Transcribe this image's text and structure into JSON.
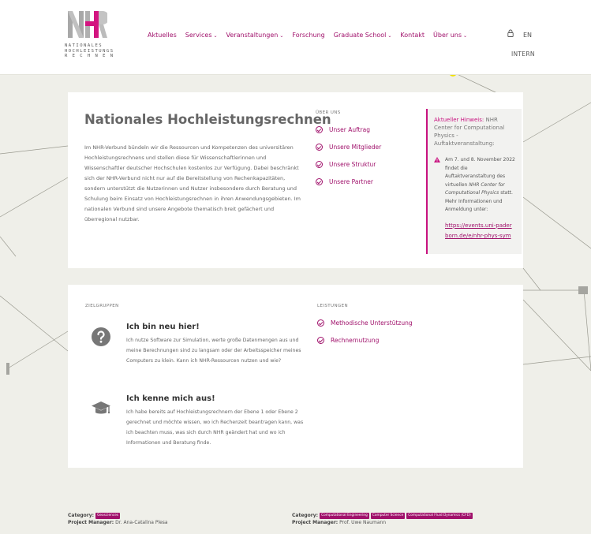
{
  "header": {
    "logo_lines": [
      "NATIONALES",
      "HOCHLEISTUNGS",
      "R E C H N E N"
    ],
    "nav": [
      {
        "label": "Aktuelles",
        "has_dropdown": false
      },
      {
        "label": "Services",
        "has_dropdown": true
      },
      {
        "label": "Veranstaltungen",
        "has_dropdown": true
      },
      {
        "label": "Forschung",
        "has_dropdown": false
      },
      {
        "label": "Graduate School",
        "has_dropdown": true
      },
      {
        "label": "Kontakt",
        "has_dropdown": false
      },
      {
        "label": "Über uns",
        "has_dropdown": true
      }
    ],
    "chevron": "⌄",
    "lang": "EN",
    "intern": "INTERN"
  },
  "about": {
    "title": "Nationales Hochleistungsrechnen",
    "intro": "Im NHR-Verbund bündeln wir die Ressourcen und Kompetenzen des universitären Hochleistungsrechnens und stellen diese für Wissenschaftlerinnen und Wissenschaftler deutscher Hochschulen kostenlos zur Verfügung. Dabei beschränkt sich der NHR-Verbund nicht nur auf die Bereitstellung von Rechenkapazitäten, sondern unterstützt die Nutzerinnen und Nutzer insbesondere durch Beratung und Schulung beim Einsatz von Hochleistungsrechnen in ihren Anwendungsgebieten. Im nationalen Verbund sind unsere Angebote thematisch breit gefächert und überregional nutzbar.",
    "links_label": "ÜBER UNS",
    "links": [
      "Unser Auftrag",
      "Unsere Mitglieder",
      "Unsere Struktur",
      "Unsere Partner"
    ]
  },
  "notice": {
    "title_prefix": "Aktueller Hinweis:",
    "title_rest": " NHR Center for Computational Physics - Auftaktveranstaltung:",
    "body_part1": "Am 7. und 8. November 2022 findet die Auftaktveranstaltung des virtuellen ",
    "body_em": "NHR Center for Computational Physics",
    "body_part2": " statt. Mehr Informationen und Anmeldung unter:",
    "link": "https://events.uni-paderborn.de/e/nhr-phys-sym"
  },
  "audiences": {
    "label": "ZIELGRUPPEN",
    "items": [
      {
        "icon": "question-icon",
        "title": "Ich bin neu hier!",
        "text": "Ich nutze Software zur Simulation, werte große Datenmengen aus und meine Berechnungen sind zu langsam oder der Arbeitsspeicher meines Computers zu klein. Kann ich NHR-Ressourcen nutzen und wie?"
      },
      {
        "icon": "graduation-cap-icon",
        "title": "Ich kenne mich aus!",
        "text": "Ich habe bereits auf Hochleistungsrechnern der Ebene 1 oder Ebene 2 gerechnet und möchte wissen, wo ich Rechenzeit beantragen kann, was ich beachten muss, was sich durch NHR geändert hat und wo ich Informationen und Beratung finde."
      }
    ]
  },
  "services": {
    "label": "LEISTUNGEN",
    "links": [
      "Methodische Unterstützung",
      "Rechnernutzung"
    ]
  },
  "footer": {
    "category_label": "Category:",
    "manager_label": "Project Manager:",
    "left": {
      "tags": [
        "Geosciences"
      ],
      "manager": "Dr. Ana-Catalina Plesa"
    },
    "right": {
      "tags": [
        "Computational Engineering",
        "Computer Science",
        "Computational Fluid Dynamics (CFD)"
      ],
      "manager": "Prof. Uwe Naumann"
    }
  },
  "colors": {
    "accent": "#a0116b",
    "notice_accent": "#c8127f",
    "background": "#efefe9",
    "logo_yellow": "#f0e000"
  }
}
